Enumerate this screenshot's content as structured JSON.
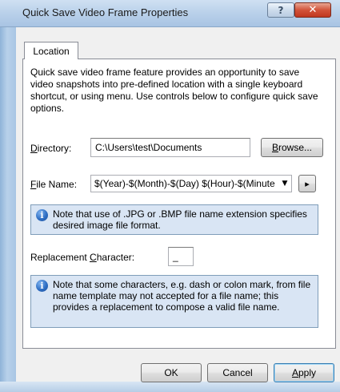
{
  "window": {
    "title": "Quick Save Video Frame Properties",
    "help_glyph": "?",
    "close_glyph": "✕"
  },
  "tabs": [
    {
      "label": "Location"
    }
  ],
  "description": "Quick save video frame feature provides an opportunity to save video snapshots into pre-defined location with a single keyboard shortcut, or using menu. Use controls below to configure quick save options.",
  "directory": {
    "label_mnemonic": "D",
    "label_rest": "irectory:",
    "value": "C:\\Users\\test\\Documents",
    "browse_mnemonic": "B",
    "browse_rest": "rowse..."
  },
  "filename": {
    "label_mnemonic": "F",
    "label_rest": "ile Name:",
    "value": "$(Year)-$(Month)-$(Day) $(Hour)-$(Minute",
    "arrow_glyph": "▼",
    "insert_glyph": "▸"
  },
  "note1": "Note that use of .JPG or .BMP file name extension specifies desired image file format.",
  "replacement": {
    "label_before": "Replacement ",
    "label_mnemonic": "C",
    "label_rest": "haracter:",
    "value": "_"
  },
  "note2": "Note that some characters, e.g. dash or colon mark, from file name template may not accepted for a file name; this provides a replacement to compose a valid file name.",
  "buttons": {
    "ok": "OK",
    "cancel": "Cancel",
    "apply_mnemonic": "A",
    "apply_rest": "pply"
  },
  "icons": {
    "info": "info-icon",
    "help": "help-icon",
    "close": "close-icon",
    "dropdown": "chevron-down-icon",
    "insert": "arrow-right-icon"
  }
}
